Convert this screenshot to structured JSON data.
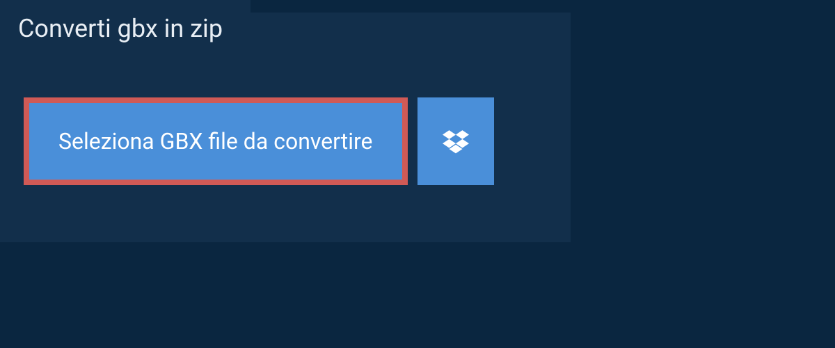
{
  "tab": {
    "title": "Converti gbx in zip"
  },
  "actions": {
    "select_file_label": "Seleziona GBX file da convertire",
    "dropbox_icon": "dropbox-icon"
  },
  "colors": {
    "background": "#0a2640",
    "panel": "#122f4b",
    "button": "#4a8fd9",
    "highlight_border": "#d05a56",
    "text_light": "#e8eef4",
    "text_white": "#ffffff"
  }
}
